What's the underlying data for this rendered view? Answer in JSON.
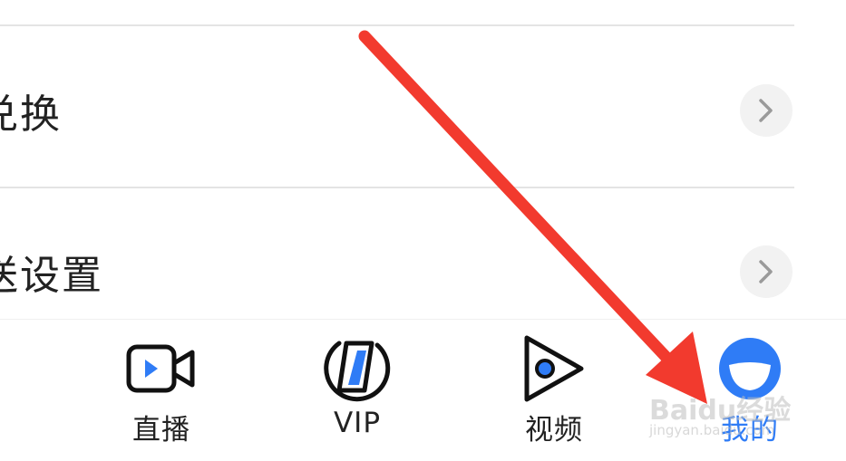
{
  "settings": {
    "rows": [
      {
        "label": "兑换",
        "chevron_icon": "chevron-right-icon"
      },
      {
        "label": "送设置",
        "chevron_icon": "chevron-right-icon"
      }
    ]
  },
  "tabbar": {
    "tabs": [
      {
        "label": "直播",
        "icon": "live-camera-icon",
        "active": false
      },
      {
        "label": "VIP",
        "icon": "vip-icon",
        "active": false
      },
      {
        "label": "视频",
        "icon": "video-play-icon",
        "active": false
      },
      {
        "label": "我的",
        "icon": "profile-smile-icon",
        "active": true
      }
    ]
  },
  "annotation": {
    "type": "red-arrow",
    "color": "#f23a2e",
    "points_to": "我的"
  },
  "watermark": {
    "line1": "Baidu经验",
    "line2": "jingyan.baidu.com"
  },
  "colors": {
    "accent": "#2f7cf6",
    "text": "#222222",
    "arrow": "#f23a2e"
  }
}
